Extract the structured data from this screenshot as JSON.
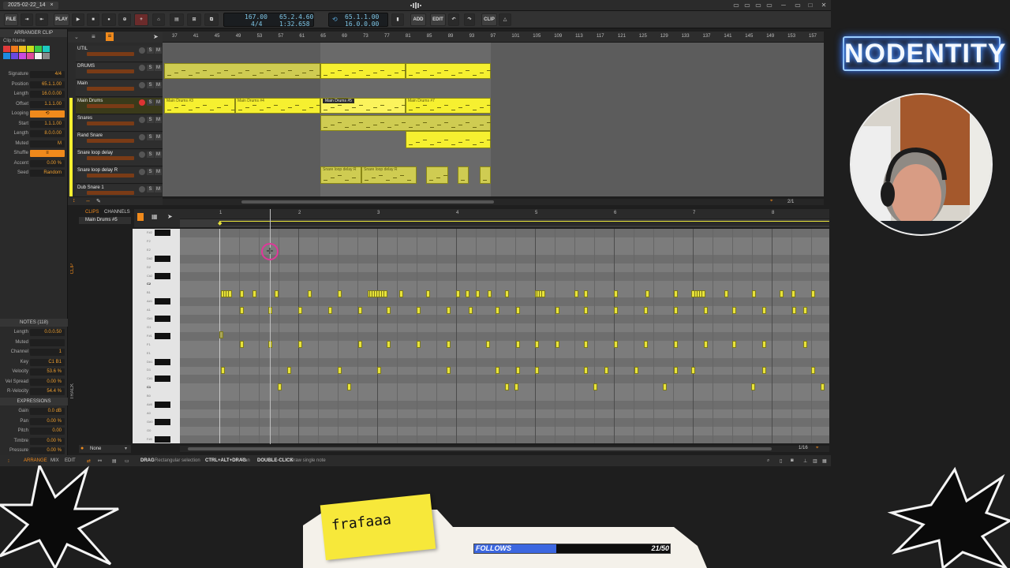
{
  "window": {
    "tab_title": "2025-02-22_14",
    "tab_close": "×",
    "min": "─",
    "max": "□",
    "close": "✕"
  },
  "transport": {
    "file_label": "FILE",
    "play_label": "PLAY",
    "tempo": "167.00",
    "time_signature": "4/4",
    "position_beats": "65.2.4.60",
    "position_time": "1:32.658",
    "loop_start": "65.1.1.00",
    "loop_length": "16.0.0.00",
    "add_label": "ADD",
    "edit_label": "EDIT",
    "clip_label": "CLIP"
  },
  "inspector": {
    "section_title": "ARRANGER CLIP",
    "clip_name_label": "Clip Name",
    "swatches": [
      "#e03a3a",
      "#f07a1c",
      "#f0c01c",
      "#c9e01c",
      "#3ac94a",
      "#1cc9c0",
      "#1c8ae0",
      "#6a4ae0",
      "#c94ae0",
      "#e04a9a",
      "#f2f2f2",
      "#8a8a8a"
    ],
    "fields": [
      {
        "label": "Signature",
        "value": "4/4"
      },
      {
        "label": "Position",
        "value": "65.1.1.00"
      },
      {
        "label": "Length",
        "value": "16.0.0.00"
      },
      {
        "label": "Offset",
        "value": "1.1.1.00"
      },
      {
        "label": "Looping",
        "value": "⟲"
      },
      {
        "label": "Start",
        "value": "1.1.1.00"
      },
      {
        "label": "Length",
        "value": "8.0.0.00"
      },
      {
        "label": "Muted",
        "value": "M"
      },
      {
        "label": "Shuffle",
        "value": "≡"
      },
      {
        "label": "Accent",
        "value": "0.00 %"
      },
      {
        "label": "Seed",
        "value": "Random"
      }
    ],
    "notes_title": "NOTES (118)",
    "note_fields": [
      {
        "label": "Length",
        "value": "0.0.0.50"
      },
      {
        "label": "Muted",
        "value": ""
      },
      {
        "label": "Channel",
        "value": "1"
      },
      {
        "label": "Key",
        "value": "C1 B1"
      },
      {
        "label": "Velocity",
        "value": "53.6 %"
      },
      {
        "label": "Vel Spread",
        "value": "0.00 %"
      },
      {
        "label": "R-Velocity",
        "value": "54.4 %"
      }
    ],
    "expressions_title": "EXPRESSIONS",
    "expr_fields": [
      {
        "label": "Gain",
        "value": "0.0 dB"
      },
      {
        "label": "Pan",
        "value": "0.00 %"
      },
      {
        "label": "Pitch",
        "value": "0.00"
      },
      {
        "label": "Timbre",
        "value": "0.00 %"
      },
      {
        "label": "Pressure",
        "value": "0.00 %"
      }
    ]
  },
  "arranger": {
    "ruler": [
      "37",
      "41",
      "45",
      "49",
      "53",
      "57",
      "61",
      "65",
      "69",
      "73",
      "77",
      "81",
      "85",
      "89",
      "93",
      "97",
      "101",
      "105",
      "109",
      "113",
      "117",
      "121",
      "125",
      "129",
      "133",
      "137",
      "141",
      "145",
      "149",
      "153",
      "157"
    ],
    "tracks": [
      {
        "name": "UTIL"
      },
      {
        "name": "DRUMS"
      },
      {
        "name": "Main"
      },
      {
        "name": "Main Drums"
      },
      {
        "name": "Snares"
      },
      {
        "name": "Rand Snare"
      },
      {
        "name": "Snare loop delay"
      },
      {
        "name": "Snare loop delay R"
      },
      {
        "name": "Dub Snare 1"
      }
    ],
    "clips": [
      "Main Drums #3",
      "Main Drums #4",
      "Main Drums #5",
      "Main Drums #7",
      "Snare loop delay R",
      "Snare loop delay R"
    ],
    "zoom": "2/1"
  },
  "detail": {
    "tab_clips": "CLIPS",
    "tab_channels": "CHANNELS",
    "clip_name": "Main Drums #5",
    "ruler": [
      "1",
      "2",
      "3",
      "4",
      "5",
      "6",
      "7",
      "8"
    ],
    "keys": [
      "F#2",
      "F2",
      "E2",
      "D#2",
      "D2",
      "C#2",
      "C2",
      "B1",
      "A#1",
      "A1",
      "G#1",
      "G1",
      "F#1",
      "F1",
      "E1",
      "D#1",
      "D1",
      "C#1",
      "C1",
      "B0",
      "A#0",
      "A0",
      "G#0",
      "G0",
      "F#0"
    ],
    "side_clip": "CLIP",
    "side_track": "TRACK",
    "scale": "None",
    "grid": "1/16"
  },
  "statusbar": {
    "arrange": "ARRANGE",
    "mix": "MIX",
    "edit": "EDIT",
    "hint1_key": "DRAG",
    "hint1_text": "Rectangular selection",
    "hint2_key": "CTRL+ALT+DRAG",
    "hint2_text": "Pan",
    "hint3_key": "DOUBLE-CLICK",
    "hint3_text": "Draw single note"
  },
  "overlay": {
    "brand": "NODENTITY",
    "sticky_note": "frafaaa",
    "follows_label": "FOLLOWS",
    "follows_count": "21/50",
    "follows_progress": 0.42
  }
}
